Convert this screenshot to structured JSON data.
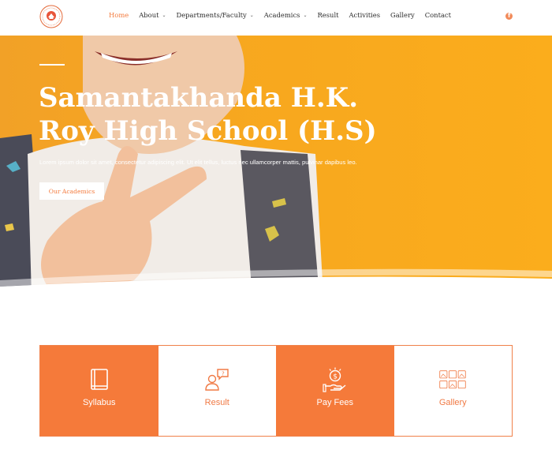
{
  "header": {
    "logo_icon": "school-crest-icon",
    "nav": [
      {
        "label": "Home",
        "active": true,
        "has_dropdown": false
      },
      {
        "label": "About",
        "active": false,
        "has_dropdown": true
      },
      {
        "label": "Departments/Faculty",
        "active": false,
        "has_dropdown": true
      },
      {
        "label": "Academics",
        "active": false,
        "has_dropdown": true
      },
      {
        "label": "Result",
        "active": false,
        "has_dropdown": false
      },
      {
        "label": "Activities",
        "active": false,
        "has_dropdown": false
      },
      {
        "label": "Gallery",
        "active": false,
        "has_dropdown": false
      },
      {
        "label": "Contact",
        "active": false,
        "has_dropdown": false
      }
    ],
    "social_icon": "facebook-icon"
  },
  "hero": {
    "title": "Samantakhanda H.K. Roy High School (H.S)",
    "subtitle": "Lorem ipsum dolor sit amet, consectetur adipiscing elit. Ut elit tellus, luctus nec ullamcorper mattis, pulvinar dapibus leo.",
    "button_label": "Our Academics"
  },
  "cards": [
    {
      "label": "Syllabus",
      "icon": "book-icon",
      "style": "filled"
    },
    {
      "label": "Result",
      "icon": "user-chat-icon",
      "style": "plain"
    },
    {
      "label": "Pay Fees",
      "icon": "coin-hand-icon",
      "style": "filled"
    },
    {
      "label": "Gallery",
      "icon": "image-grid-icon",
      "style": "plain"
    }
  ],
  "colors": {
    "accent": "#f47b3e",
    "hero_bg": "#f7a71f",
    "card_filled": "#f57a3a"
  }
}
